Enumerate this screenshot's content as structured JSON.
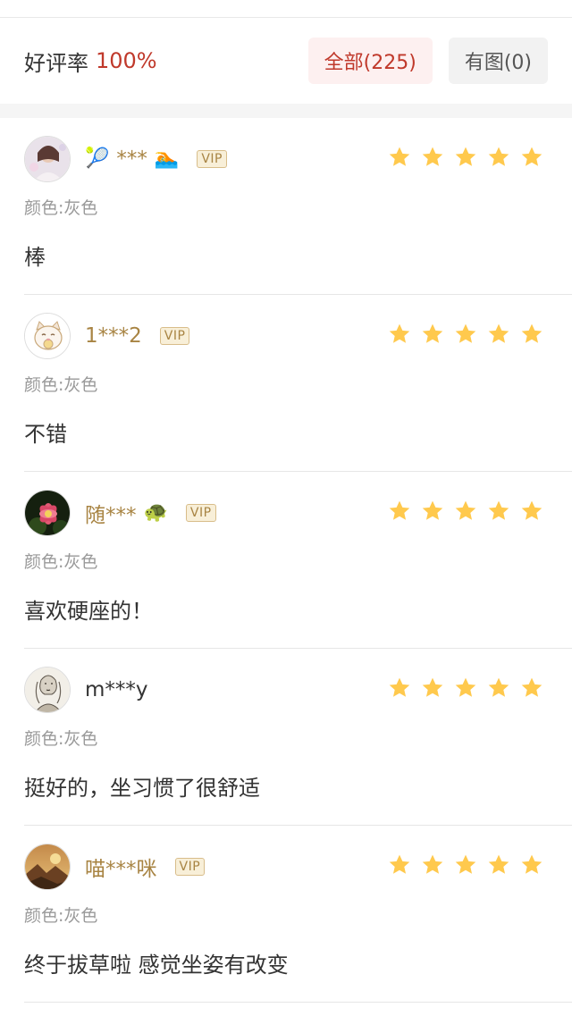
{
  "summary": {
    "rate_label": "好评率",
    "rate_value": "100%",
    "filter_all": "全部(225)",
    "filter_with_photos": "有图(0)"
  },
  "colors": {
    "accent": "#c0392b",
    "vip_name": "#a88443",
    "star": "#ffc94d",
    "muted": "#999999"
  },
  "reviews": [
    {
      "username": "***",
      "prefix_emoji": "🎾",
      "suffix_emoji": "🏊",
      "vip": true,
      "vip_label": "VIP",
      "rating": 5,
      "spec": "颜色:灰色",
      "content": "棒",
      "avatar_icon": "woman-portrait-avatar"
    },
    {
      "username": "1***2",
      "prefix_emoji": "",
      "suffix_emoji": "",
      "vip": true,
      "vip_label": "VIP",
      "rating": 5,
      "spec": "颜色:灰色",
      "content": "不错",
      "avatar_icon": "lucky-cat-avatar"
    },
    {
      "username": "随***",
      "prefix_emoji": "",
      "suffix_emoji": "🐢",
      "vip": true,
      "vip_label": "VIP",
      "rating": 5,
      "spec": "颜色:灰色",
      "content": "喜欢硬座的！",
      "avatar_icon": "lotus-flower-avatar"
    },
    {
      "username": "m***y",
      "prefix_emoji": "",
      "suffix_emoji": "",
      "vip": false,
      "vip_label": "",
      "rating": 5,
      "spec": "颜色:灰色",
      "content": "挺好的，坐习惯了很舒适",
      "avatar_icon": "sketch-portrait-avatar"
    },
    {
      "username": "喵***咪",
      "prefix_emoji": "",
      "suffix_emoji": "",
      "vip": true,
      "vip_label": "VIP",
      "rating": 5,
      "spec": "颜色:灰色",
      "content": "终于拔草啦 感觉坐姿有改变",
      "avatar_icon": "sunset-landscape-avatar"
    }
  ]
}
